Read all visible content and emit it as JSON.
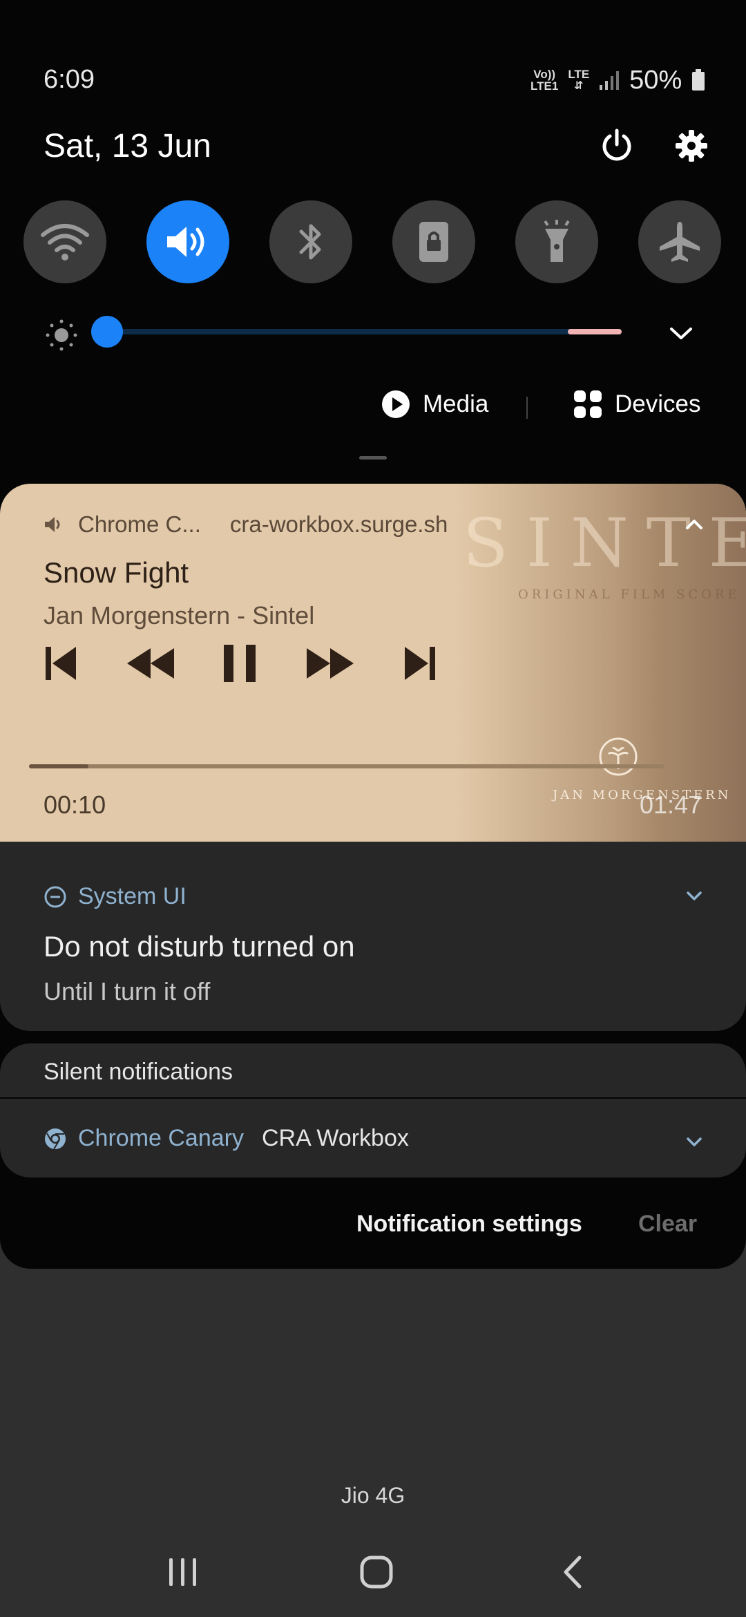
{
  "status_bar": {
    "time": "6:09",
    "volte_label_top": "Vo))",
    "volte_label_bottom": "LTE1",
    "lte_label": "LTE",
    "battery": "50%"
  },
  "header": {
    "date": "Sat, 13 Jun"
  },
  "quick_toggles": [
    {
      "name": "wifi",
      "on": false
    },
    {
      "name": "sound",
      "on": true
    },
    {
      "name": "bluetooth",
      "on": false
    },
    {
      "name": "screen-lock",
      "on": false
    },
    {
      "name": "flashlight",
      "on": false
    },
    {
      "name": "airplane",
      "on": false
    }
  ],
  "brightness": {
    "level": 0.02
  },
  "media_bar": {
    "media_label": "Media",
    "devices_label": "Devices"
  },
  "media_card": {
    "app": "Chrome C...",
    "source": "cra-workbox.surge.sh",
    "title": "Snow Fight",
    "artist": "Jan Morgenstern - Sintel",
    "elapsed": "00:10",
    "duration": "01:47",
    "progress": 0.093,
    "art": {
      "title": "SINTE",
      "subtitle": "ORIGINAL FILM SCORE",
      "credit": "JAN MORGENSTERN"
    }
  },
  "notifications": {
    "system_ui": {
      "app": "System UI",
      "title": "Do not disturb turned on",
      "text": "Until I turn it off"
    },
    "silent_header": "Silent notifications",
    "chrome": {
      "app": "Chrome Canary",
      "title": "CRA Workbox"
    }
  },
  "footer": {
    "settings_label": "Notification settings",
    "clear_label": "Clear"
  },
  "carrier": "Jio 4G",
  "colors": {
    "accent": "#1b82f7",
    "panel": "#050505",
    "card": "#272728"
  }
}
